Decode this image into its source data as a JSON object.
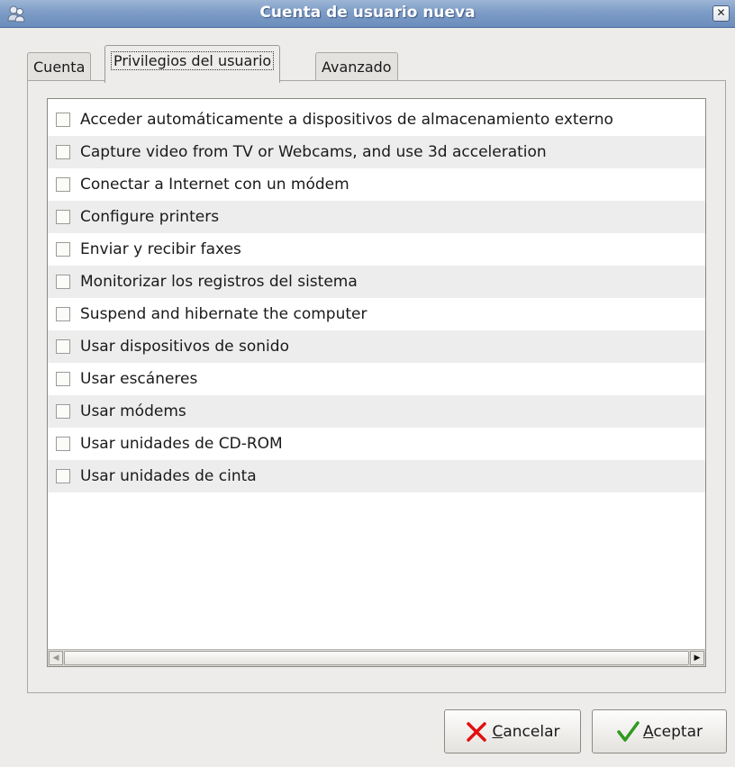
{
  "window": {
    "title": "Cuenta de usuario nueva",
    "close_glyph": "✕"
  },
  "tabs": [
    {
      "label": "Cuenta",
      "active": false
    },
    {
      "label": "Privilegios del usuario",
      "active": true
    },
    {
      "label": "Avanzado",
      "active": false
    }
  ],
  "privileges": [
    {
      "label": "Acceder automáticamente a dispositivos de almacenamiento externo",
      "checked": false
    },
    {
      "label": "Capture video from TV or Webcams, and use 3d acceleration",
      "checked": false
    },
    {
      "label": "Conectar a Internet con un módem",
      "checked": false
    },
    {
      "label": "Configure printers",
      "checked": false
    },
    {
      "label": "Enviar y recibir faxes",
      "checked": false
    },
    {
      "label": "Monitorizar los registros del sistema",
      "checked": false
    },
    {
      "label": "Suspend and hibernate the computer",
      "checked": false
    },
    {
      "label": "Usar dispositivos de sonido",
      "checked": false
    },
    {
      "label": "Usar escáneres",
      "checked": false
    },
    {
      "label": "Usar módems",
      "checked": false
    },
    {
      "label": "Usar unidades de CD-ROM",
      "checked": false
    },
    {
      "label": "Usar unidades de cinta",
      "checked": false
    }
  ],
  "buttons": {
    "cancel": {
      "mnemonic": "C",
      "rest": "ancelar",
      "icon": "red-x-icon",
      "color": "#e01010"
    },
    "ok": {
      "mnemonic": "A",
      "rest": "ceptar",
      "icon": "green-check-icon",
      "color": "#2e9a1e"
    }
  },
  "colors": {
    "titlebar": "#7d9cc6",
    "window_bg": "#edeceb",
    "row_alt": "#ededed"
  }
}
